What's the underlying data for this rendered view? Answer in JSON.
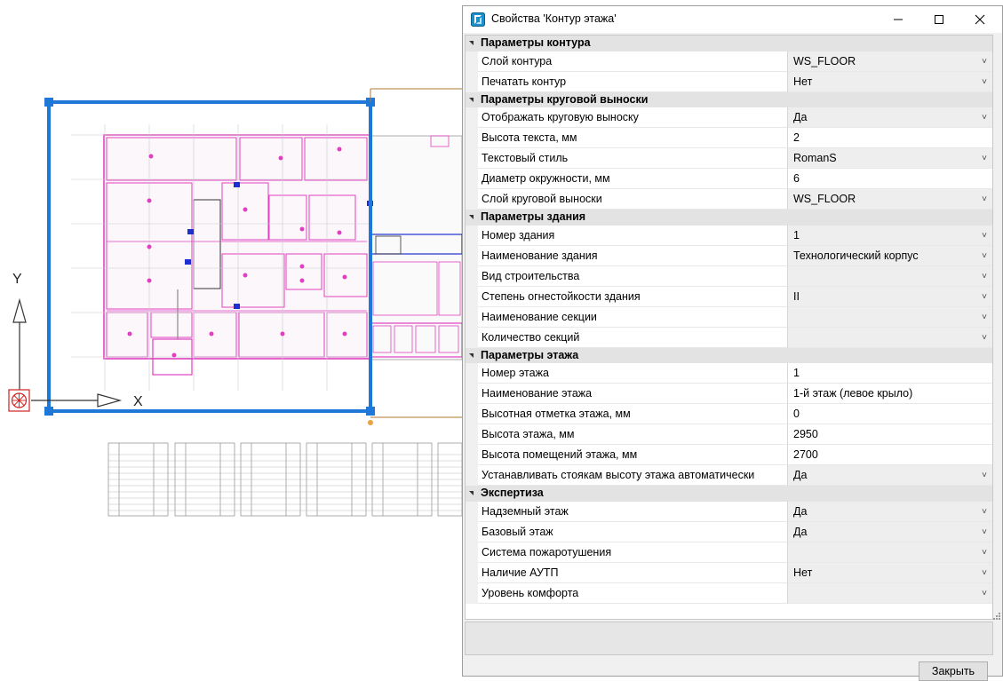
{
  "dialog": {
    "title": "Свойства 'Контур этажа'",
    "close_button": "Закрыть",
    "icons": {
      "app": "app-icon",
      "minimize": "minimize-icon",
      "maximize": "maximize-icon",
      "close": "close-icon",
      "dropdown": "chevron-down-icon"
    }
  },
  "categories": [
    {
      "title": "Параметры контура",
      "rows": [
        {
          "name": "Слой контура",
          "value": "WS_FLOOR",
          "dropdown": true
        },
        {
          "name": "Печатать контур",
          "value": "Нет",
          "dropdown": true
        }
      ]
    },
    {
      "title": "Параметры круговой выноски",
      "rows": [
        {
          "name": "Отображать круговую выноску",
          "value": "Да",
          "dropdown": true
        },
        {
          "name": "Высота текста, мм",
          "value": "2",
          "dropdown": false
        },
        {
          "name": "Текстовый стиль",
          "value": "RomanS",
          "dropdown": true
        },
        {
          "name": "Диаметр окружности, мм",
          "value": "6",
          "dropdown": false
        },
        {
          "name": "Слой круговой выноски",
          "value": "WS_FLOOR",
          "dropdown": true
        }
      ]
    },
    {
      "title": "Параметры здания",
      "rows": [
        {
          "name": "Номер здания",
          "value": "1",
          "dropdown": true
        },
        {
          "name": "Наименование здания",
          "value": "Технологический корпус",
          "dropdown": true
        },
        {
          "name": "Вид строительства",
          "value": "",
          "dropdown": true
        },
        {
          "name": "Степень огнестойкости здания",
          "value": "II",
          "dropdown": true
        },
        {
          "name": "Наименование секции",
          "value": "",
          "dropdown": true
        },
        {
          "name": "Количество секций",
          "value": "",
          "dropdown": true
        }
      ]
    },
    {
      "title": "Параметры этажа",
      "rows": [
        {
          "name": "Номер этажа",
          "value": "1",
          "dropdown": false
        },
        {
          "name": "Наименование этажа",
          "value": "1-й этаж (левое крыло)",
          "dropdown": false
        },
        {
          "name": "Высотная отметка этажа, мм",
          "value": "0",
          "dropdown": false
        },
        {
          "name": "Высота этажа, мм",
          "value": "2950",
          "dropdown": false
        },
        {
          "name": "Высота помещений этажа, мм",
          "value": "2700",
          "dropdown": false
        },
        {
          "name": "Устанавливать стоякам высоту этажа автоматически",
          "value": "Да",
          "dropdown": true
        }
      ]
    },
    {
      "title": "Экспертиза",
      "rows": [
        {
          "name": "Надземный этаж",
          "value": "Да",
          "dropdown": true
        },
        {
          "name": "Базовый этаж",
          "value": "Да",
          "dropdown": true
        },
        {
          "name": "Система пожаротушения",
          "value": "",
          "dropdown": true
        },
        {
          "name": "Наличие АУТП",
          "value": "Нет",
          "dropdown": true
        },
        {
          "name": "Уровень комфорта",
          "value": "",
          "dropdown": true
        }
      ]
    }
  ],
  "drawing": {
    "axis_x_label": "X",
    "axis_y_label": "Y",
    "colors": {
      "selection": "#1e78d7",
      "plan_lines": "#e040c0",
      "wall": "#888888",
      "stair": "#333333",
      "ucs_marker": "#d02020",
      "leader": "#b07830"
    }
  }
}
